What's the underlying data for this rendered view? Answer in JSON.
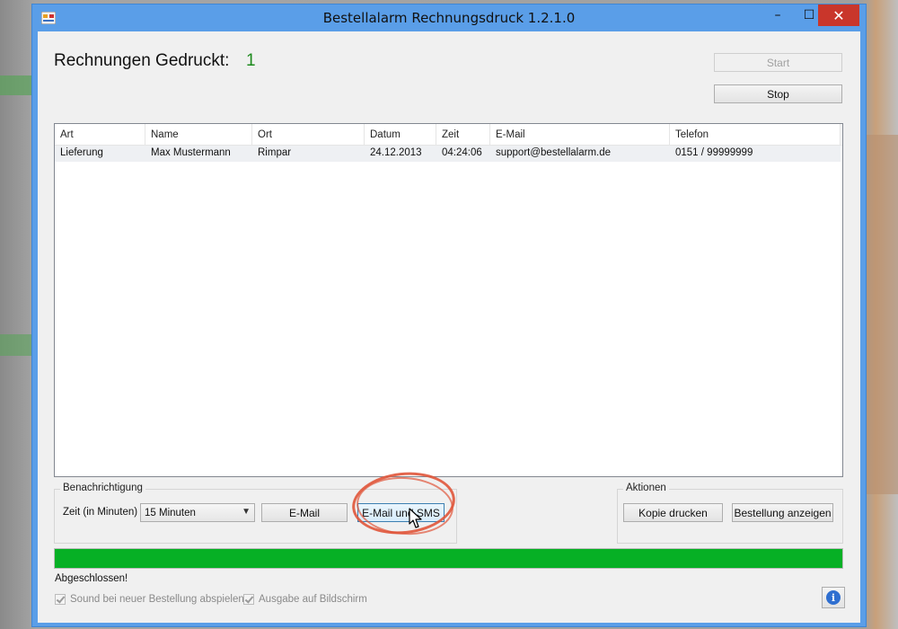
{
  "window": {
    "title": "Bestellalarm Rechnungsdruck 1.2.1.0",
    "controls": {
      "minimize": "–",
      "maximize": "☐",
      "close": "✕"
    }
  },
  "header": {
    "counter_label": "Rechnungen Gedruckt:",
    "counter_value": "1"
  },
  "toolbar": {
    "start_label": "Start",
    "stop_label": "Stop"
  },
  "list": {
    "columns": [
      "Art",
      "Name",
      "Ort",
      "Datum",
      "Zeit",
      "E-Mail",
      "Telefon"
    ],
    "rows": [
      [
        "Lieferung",
        "Max Mustermann",
        "Rimpar",
        "24.12.2013",
        "04:24:06",
        "support@bestellalarm.de",
        "0151 / 99999999"
      ]
    ]
  },
  "notify": {
    "group_title": "Benachrichtigung",
    "zeit_label": "Zeit (in Minuten)",
    "zeit_selected": "15 Minuten",
    "email_label": "E-Mail",
    "email_sms_label": "E-Mail und SMS"
  },
  "actions": {
    "group_title": "Aktionen",
    "kopie_label": "Kopie drucken",
    "bestellung_label": "Bestellung anzeigen"
  },
  "progress": {
    "fraction": 1.0,
    "color": "#06b025"
  },
  "status": {
    "text": "Abgeschlossen!"
  },
  "options": {
    "sound_label": "Sound bei neuer Bestellung abspielen",
    "ausgabe_label": "Ausgabe auf Bildschirm"
  },
  "colors": {
    "accent_green": "#1c8a1c",
    "highlight": "#e0553a",
    "close_red": "#c9362b"
  }
}
